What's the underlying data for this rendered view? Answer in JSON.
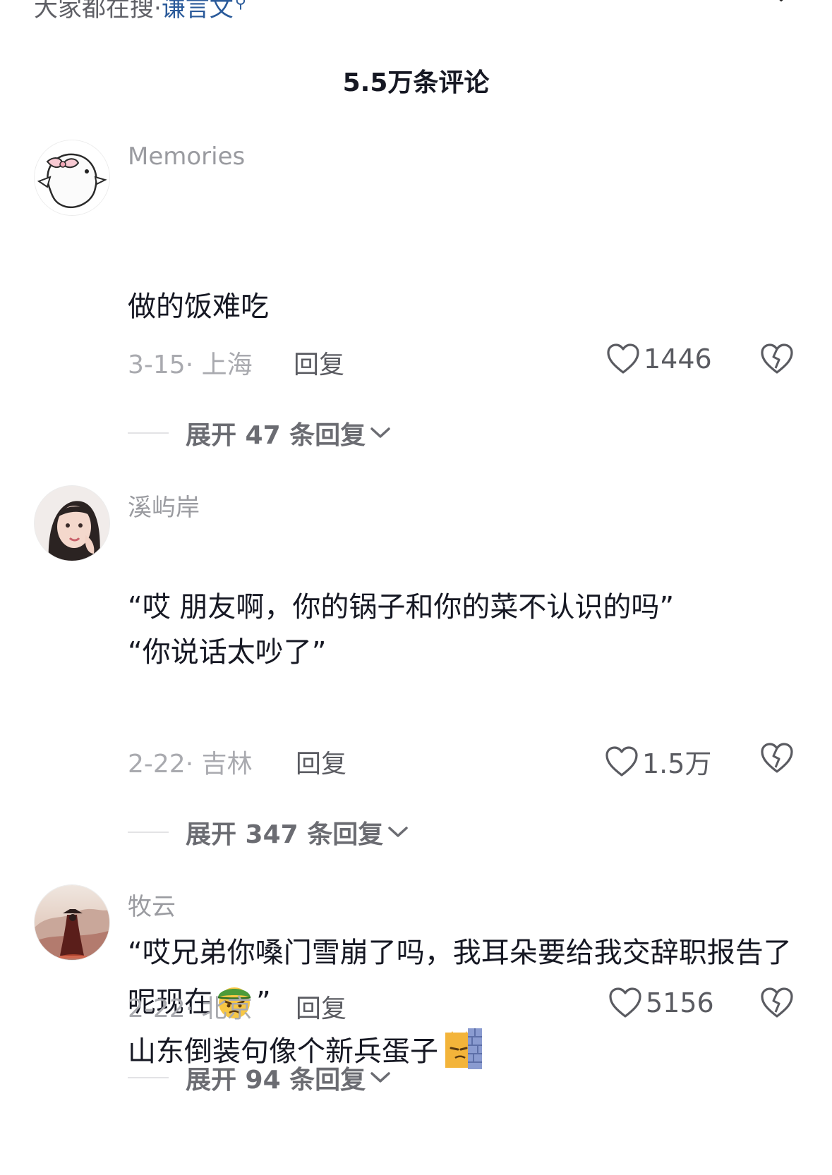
{
  "top_bar": {
    "prefix": "大家都在搜·",
    "keyword": "谦言文",
    "search_icon": "search-icon",
    "close_icon": "close-icon"
  },
  "header": {
    "title": "5.5万条评论"
  },
  "comments": [
    {
      "username": "Memories",
      "avatar": "cartoon-duck-with-bow",
      "text_line1": "做的饭难吃",
      "text_line2": "“哎 朋友啊，你的锅子和你的菜不认识的吗”",
      "date_location": "3-15· 上海",
      "reply_label": "回复",
      "likes": "1446",
      "expand_label": "展开 47 条回复"
    },
    {
      "username": "溪屿岸",
      "avatar": "selfie-girl",
      "text_line1": "“你说话太吵了”",
      "text_line2": "“哎兄弟你嗓门雪崩了吗，我耳朵要给我交辞职报告了呢现在",
      "text_line2_end": "”",
      "emoji": "green-hat-grumpy-emoji",
      "date_location": "2-22· 吉林",
      "reply_label": "回复",
      "likes": "1.5万",
      "expand_label": "展开 347 条回复"
    },
    {
      "username": "牧云",
      "avatar": "swordsman-painting",
      "text_line1": "山东倒装句像个新兵蛋子",
      "emoji": "cat-behind-wall-emoji",
      "date_location": "2-22· 北京",
      "reply_label": "回复",
      "likes": "5156",
      "expand_label": "展开 94 条回复"
    }
  ],
  "colors": {
    "text_primary": "#161823",
    "text_secondary": "#a9aaaf",
    "username": "#9a9ba0",
    "keyword_blue": "#2a5a9a"
  }
}
